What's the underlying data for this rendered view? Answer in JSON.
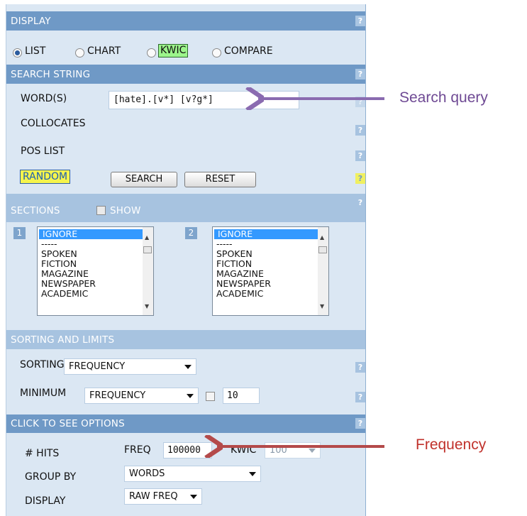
{
  "sections": {
    "display": "DISPLAY",
    "search_string": "SEARCH STRING",
    "sections_hdr": "SECTIONS",
    "sorting_limits": "SORTING AND LIMITS",
    "click_options": "CLICK TO SEE OPTIONS",
    "help": "?"
  },
  "display_modes": {
    "list": "LIST",
    "chart": "CHART",
    "kwic": "KWIC",
    "compare": "COMPARE",
    "selected": "LIST"
  },
  "search": {
    "words_label": "WORD(S)",
    "words_value": "[hate].[v*] [v?g*]",
    "collocates_label": "COLLOCATES",
    "pos_list_label": "POS LIST",
    "random_label": "RANDOM",
    "search_button": "SEARCH",
    "reset_button": "RESET"
  },
  "sections_panel": {
    "show_label": "SHOW",
    "box1_num": "1",
    "box2_num": "2",
    "items": [
      "IGNORE",
      "-----",
      "SPOKEN",
      "FICTION",
      "MAGAZINE",
      "NEWSPAPER",
      "ACADEMIC"
    ]
  },
  "sorting": {
    "sorting_label": "SORTING",
    "sorting_value": "FREQUENCY",
    "minimum_label": "MINIMUM",
    "minimum_value": "FREQUENCY",
    "minimum_number": "10"
  },
  "options": {
    "hits_label": "# HITS",
    "freq_label": "FREQ",
    "freq_value": "100000",
    "kwic_label": "KWIC",
    "kwic_value": "100",
    "group_by_label": "GROUP BY",
    "group_by_value": "WORDS",
    "display_label": "DISPLAY",
    "display_value": "RAW FREQ"
  },
  "annotations": {
    "search_query": "Search query",
    "frequency": "Frequency",
    "search_query_color": "#6f4a94",
    "frequency_color": "#c0312b",
    "purple_arrow": "#8a6bb0",
    "red_arrow": "#b44a4a"
  }
}
